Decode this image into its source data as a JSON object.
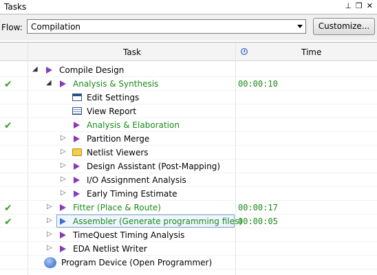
{
  "window": {
    "title": "Tasks"
  },
  "flow": {
    "label": "Flow:",
    "selected": "Compilation",
    "customize_label": "Customize..."
  },
  "columns": {
    "task": "Task",
    "time": "Time"
  },
  "rows": [
    {
      "label": "Compile Design",
      "time": ""
    },
    {
      "label": "Analysis & Synthesis",
      "time": "00:00:10"
    },
    {
      "label": "Edit Settings",
      "time": ""
    },
    {
      "label": "View Report",
      "time": ""
    },
    {
      "label": "Analysis & Elaboration",
      "time": ""
    },
    {
      "label": "Partition Merge",
      "time": ""
    },
    {
      "label": "Netlist Viewers",
      "time": ""
    },
    {
      "label": "Design Assistant (Post-Mapping)",
      "time": ""
    },
    {
      "label": "I/O Assignment Analysis",
      "time": ""
    },
    {
      "label": "Early Timing Estimate",
      "time": ""
    },
    {
      "label": "Fitter (Place & Route)",
      "time": "00:00:17"
    },
    {
      "label": "Assembler (Generate programming files)",
      "time": "00:00:05"
    },
    {
      "label": "TimeQuest Timing Analysis",
      "time": ""
    },
    {
      "label": "EDA Netlist Writer",
      "time": ""
    },
    {
      "label": "Program Device (Open Programmer)",
      "time": ""
    }
  ],
  "colors": {
    "success": "#1a8a1a",
    "task_icon": "#8a3ab9",
    "selected_icon": "#3a6fd0"
  }
}
